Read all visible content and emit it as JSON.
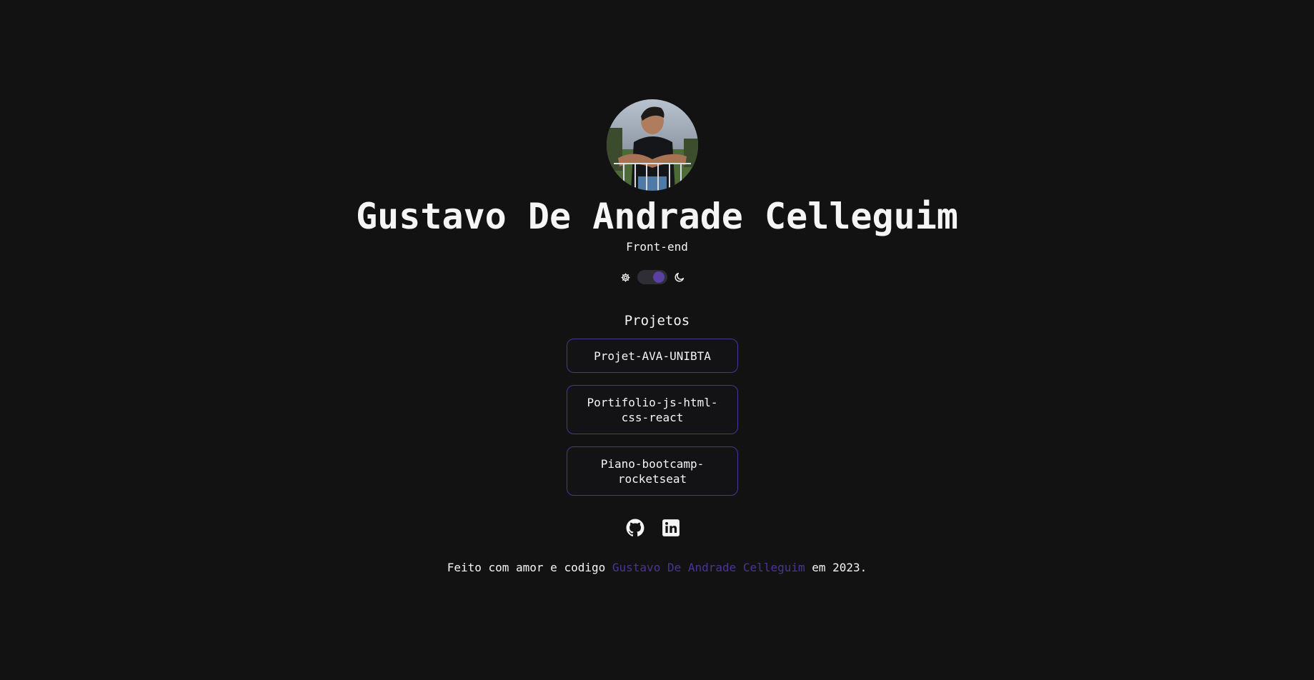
{
  "profile": {
    "name": "Gustavo De Andrade Celleguim",
    "role": "Front-end",
    "avatar_alt": "Gustavo De Andrade Celleguim"
  },
  "theme_switch": {
    "left_icon": "gear-icon",
    "right_icon": "moon-icon",
    "state": "dark",
    "accent": "#5b3fa3"
  },
  "projects": {
    "title": "Projetos",
    "items": [
      {
        "label": "Projet-AVA-UNIBTA"
      },
      {
        "label": "Portifolio-js-html-css-react"
      },
      {
        "label": "Piano-bootcamp-rocketseat"
      }
    ]
  },
  "socials": [
    {
      "icon": "github-icon"
    },
    {
      "icon": "linkedin-icon"
    }
  ],
  "footer": {
    "prefix": "Feito com amor e codigo",
    "author": "Gustavo De Andrade Celleguim",
    "suffix": "em 2023."
  },
  "colors": {
    "background": "#121213",
    "text": "#f5f5f5",
    "accent": "#4b3596"
  }
}
